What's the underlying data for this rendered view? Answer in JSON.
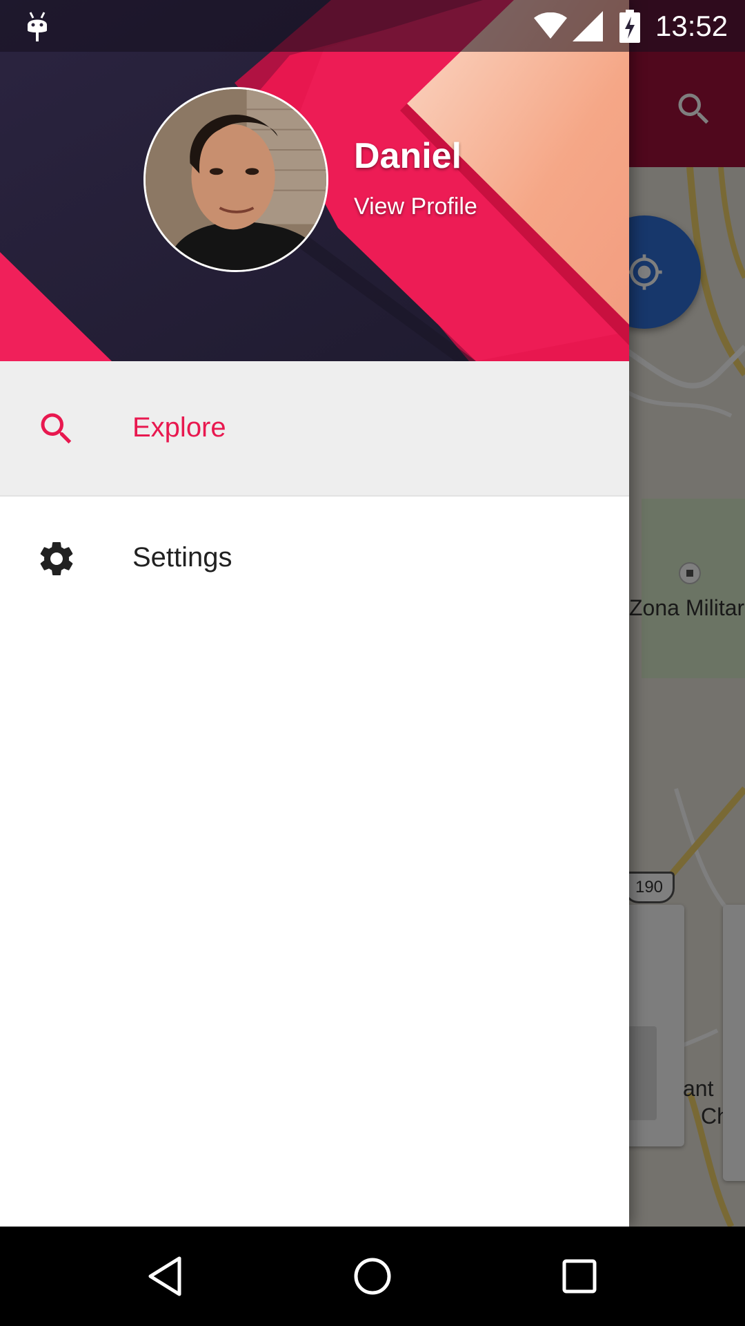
{
  "status_bar": {
    "time": "13:52",
    "icons": [
      "android-notification-icon",
      "wifi-icon",
      "cell-signal-icon",
      "battery-charging-icon"
    ]
  },
  "drawer": {
    "user_name": "Daniel",
    "view_profile_label": "View Profile",
    "items": [
      {
        "label": "Explore",
        "icon": "search-icon",
        "active": true
      },
      {
        "label": "Settings",
        "icon": "gear-icon",
        "active": false
      }
    ]
  },
  "background_app": {
    "toolbar_icon": "search-icon",
    "fab_icon": "my-location-icon",
    "map_labels": {
      "zone": "Zona Militar",
      "route_number": "190",
      "card_text_1": "ant",
      "card_text_2": "Ch"
    }
  },
  "colors": {
    "accent": "#e8184f",
    "header_dark": "#262038",
    "app_bar": "#a0103a",
    "fab": "#2f6fd6",
    "peach": "#f4a88a"
  },
  "nav_bar": {
    "buttons": [
      "back-button",
      "home-button",
      "recents-button"
    ]
  }
}
